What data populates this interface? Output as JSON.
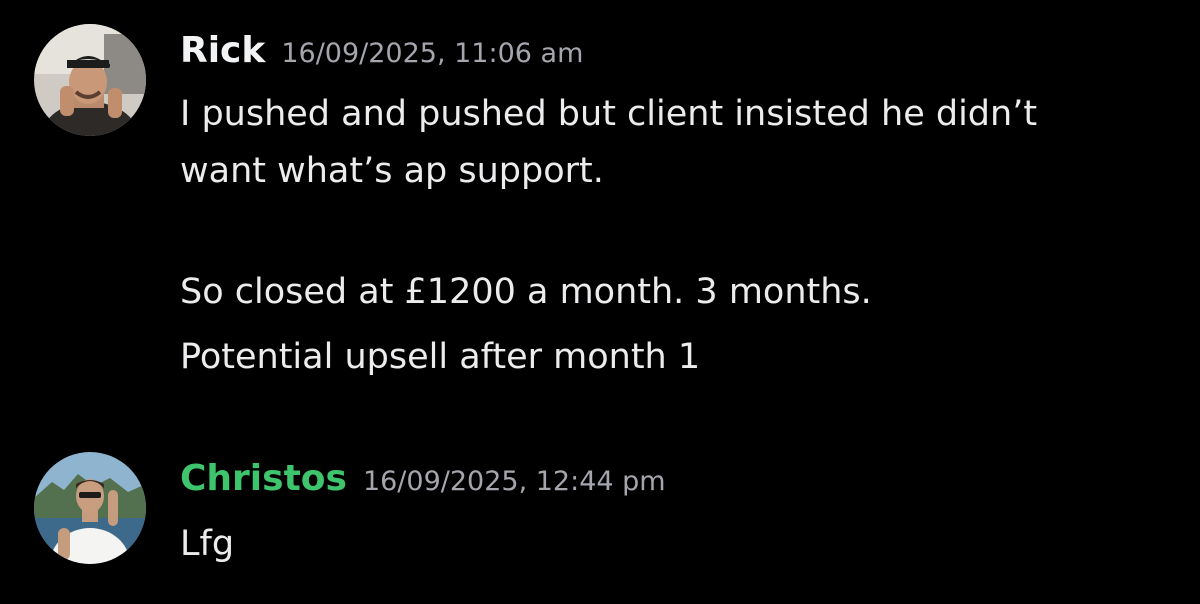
{
  "colors": {
    "background": "#000000",
    "rick_name": "#f2f3f5",
    "christos_name": "#3ec46d",
    "timestamp": "#a5a6ad",
    "text": "#ececee"
  },
  "messages": [
    {
      "author": "Rick",
      "timestamp": "16/09/2025, 11:06 am",
      "avatar_icon": "user-avatar-photo",
      "lines": [
        "I pushed and pushed but client insisted he didn’t",
        "want what’s ap support.",
        "So closed at £1200 a month. 3 months.",
        "Potential upsell after month 1"
      ]
    },
    {
      "author": "Christos",
      "timestamp": "16/09/2025, 12:44 pm",
      "avatar_icon": "user-avatar-photo",
      "lines": [
        "Lfg"
      ]
    }
  ]
}
